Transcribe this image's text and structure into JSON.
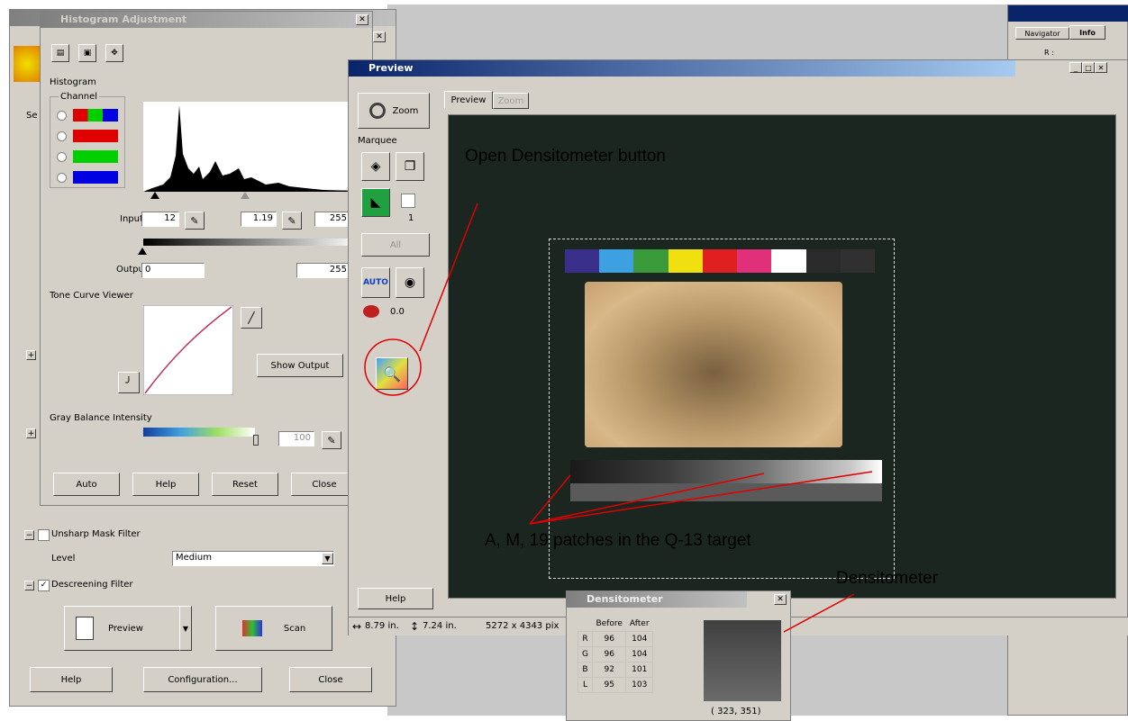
{
  "histogram_window": {
    "title": "Histogram Adjustment",
    "histogram_label": "Histogram",
    "channel_label": "Channel",
    "input_label": "Input",
    "input_black": "12",
    "input_gamma": "1.19",
    "input_white": "255",
    "output_label": "Output",
    "output_black": "0",
    "output_white": "255",
    "tone_curve_label": "Tone Curve Viewer",
    "show_output_label": "Show Output",
    "gray_balance_label": "Gray Balance Intensity",
    "gray_balance_value": "100",
    "buttons": {
      "auto": "Auto",
      "help": "Help",
      "reset": "Reset",
      "close": "Close"
    }
  },
  "main_window": {
    "unsharp_label": "Unsharp Mask Filter",
    "level_label": "Level",
    "level_value": "Medium",
    "descreening_label": "Descreening Filter",
    "preview_button": "Preview",
    "scan_button": "Scan",
    "help_button": "Help",
    "configuration_button": "Configuration...",
    "close_button": "Close",
    "group_label_fragment": "Se"
  },
  "preview_window": {
    "title": "Preview",
    "zoom_button": "Zoom",
    "marquee_label": "Marquee",
    "marquee_count": "1",
    "all_button": "All",
    "exposure_value": "0.0",
    "help_button": "Help",
    "tabs": [
      "Preview",
      "Zoom"
    ],
    "status_width": "8.79 in.",
    "status_height": "7.24 in.",
    "status_pixels": "5272 x 4343 pix"
  },
  "densitometer": {
    "title": "Densitometer",
    "headers": [
      "Before",
      "After"
    ],
    "rows": [
      {
        "ch": "R",
        "before": "96",
        "after": "104"
      },
      {
        "ch": "G",
        "before": "96",
        "after": "104"
      },
      {
        "ch": "B",
        "before": "92",
        "after": "101"
      },
      {
        "ch": "L",
        "before": "95",
        "after": "103"
      }
    ],
    "coords": "( 323,  351)"
  },
  "navigator": {
    "tabs": [
      "Navigator",
      "Info"
    ],
    "r_label": "R :"
  },
  "annotations": {
    "open_densitometer": "Open Densitometer button",
    "patches": "A, M, 19 patches in the Q-13 target",
    "densitometer": "Densitometer"
  },
  "colors": {
    "title_active": "#0a246a",
    "preview_bg": "#1b2620",
    "annotation_line": "#e00000",
    "patches": [
      "#3a2f8a",
      "#3da0e0",
      "#3a9a3a",
      "#f0e010",
      "#e02020",
      "#e0307a",
      "#ffffff",
      "#2a2a2a",
      "#303030"
    ]
  }
}
